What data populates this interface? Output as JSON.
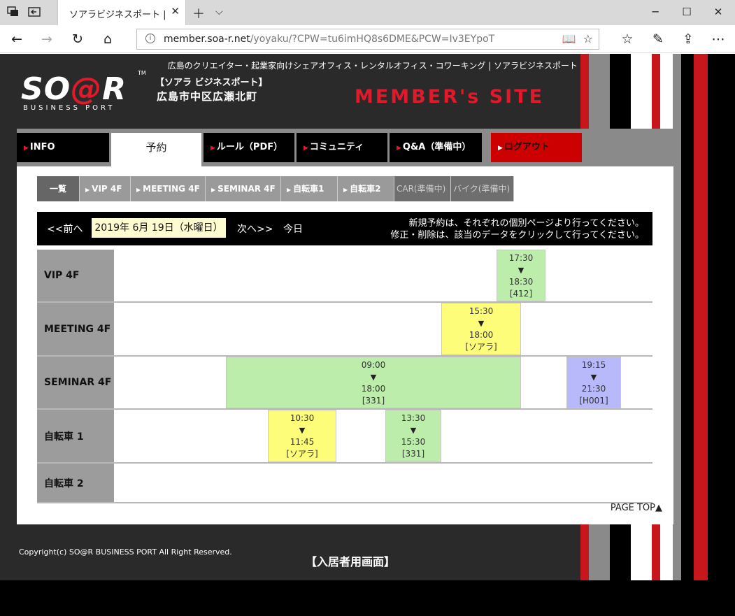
{
  "browser": {
    "tab_title": "ソアラビジネスポート | 予約",
    "url_host": "member.soa-r.net",
    "url_rest": "/yoyaku/?CPW=tu6imHQ8s6DME&PCW=Iv3EYpoT"
  },
  "header": {
    "tagline": "広島のクリエイター・起業家向けシェアオフィス・レンタルオフィス・コワーキング | ソアラビジネスポート",
    "logo_main_a": "SO",
    "logo_main_at": "@",
    "logo_main_b": "R",
    "logo_tm": "TM",
    "logo_sub": "BUSINESS PORT",
    "logo_jp1": "【ソアラ ビジネスポート】",
    "logo_jp2": "広島市中区広瀬北町",
    "member_title": "MEMBER's SITE"
  },
  "main_nav": {
    "info": "INFO",
    "yoyaku": "予約",
    "rules": "ルール（PDF）",
    "community": "コミュニティ",
    "qa": "Q&A（準備中）",
    "logout": "ログアウト"
  },
  "sub_nav": {
    "all": "一覧",
    "vip": "VIP 4F",
    "meeting": "MEETING 4F",
    "seminar": "SEMINAR 4F",
    "bike1": "自転車1",
    "bike2": "自転車2",
    "car": "CAR(準備中)",
    "motorbike": "バイク(準備中)"
  },
  "datebar": {
    "prev": "<<前へ",
    "date": "2019年 6月 19日（水曜日）",
    "next": "次へ>>",
    "today": "今日",
    "notice_1": "新規予約は、それぞれの個別ページより行ってください。",
    "notice_2": "修正・削除は、該当のデータをクリックして行ってください。"
  },
  "schedule": {
    "rows": [
      {
        "label": "VIP 4F"
      },
      {
        "label": "MEETING 4F"
      },
      {
        "label": "SEMINAR 4F"
      },
      {
        "label": "自転車 1"
      },
      {
        "label": "自転車 2"
      }
    ],
    "bookings": {
      "vip_1": {
        "start": "17:30",
        "end": "18:30",
        "who": "[412]"
      },
      "meeting_1": {
        "start": "15:30",
        "end": "18:00",
        "who": "[ソアラ]"
      },
      "seminar_1": {
        "start": "09:00",
        "end": "18:00",
        "who": "[331]"
      },
      "seminar_2": {
        "start": "19:15",
        "end": "21:30",
        "who": "[H001]"
      },
      "bike1_1": {
        "start": "10:30",
        "end": "11:45",
        "who": "[ソアラ]"
      },
      "bike1_2": {
        "start": "13:30",
        "end": "15:30",
        "who": "[331]"
      }
    },
    "arrow": "▼"
  },
  "page_top": "PAGE TOP▲",
  "footer": {
    "copyright": "Copyright(c) SO@R BUSINESS PORT All Right Reserved.",
    "label": "【入居者用画面】"
  },
  "colors": {
    "accent_red": "#e01a2b",
    "booking_green": "#bdedaa",
    "booking_yellow": "#fefd7a",
    "booking_blue": "#b8b9fb"
  }
}
